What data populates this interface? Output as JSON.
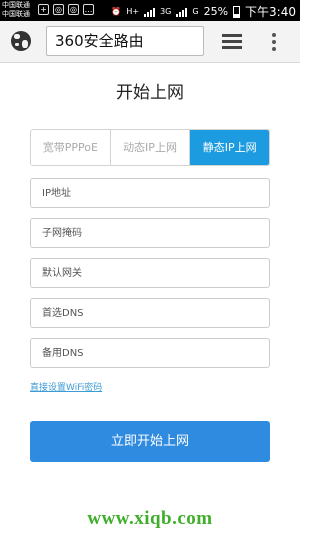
{
  "status_bar": {
    "carrier_1": "中国联通",
    "carrier_2": "中国联通",
    "network_1": "H+",
    "network_2": "3G",
    "network_3": "G",
    "battery": "25%",
    "time": "下午3:40"
  },
  "browser": {
    "address": "360安全路由"
  },
  "page": {
    "title": "开始上网",
    "tabs": [
      {
        "label": "宽带PPPoE",
        "active": false
      },
      {
        "label": "动态IP上网",
        "active": false
      },
      {
        "label": "静态IP上网",
        "active": true
      }
    ],
    "fields": {
      "ip": {
        "placeholder": "IP地址"
      },
      "subnet": {
        "placeholder": "子网掩码"
      },
      "gateway": {
        "placeholder": "默认网关"
      },
      "dns1": {
        "placeholder": "首选DNS"
      },
      "dns2": {
        "placeholder": "备用DNS"
      }
    },
    "wifi_link": "直接设置WiFi密码",
    "submit": "立即开始上网"
  },
  "watermark": "www.xiqb.com",
  "colors": {
    "accent": "#1d9be0",
    "button": "#2f8be0",
    "link": "#3d9bd6",
    "watermark": "#3fae2a"
  }
}
